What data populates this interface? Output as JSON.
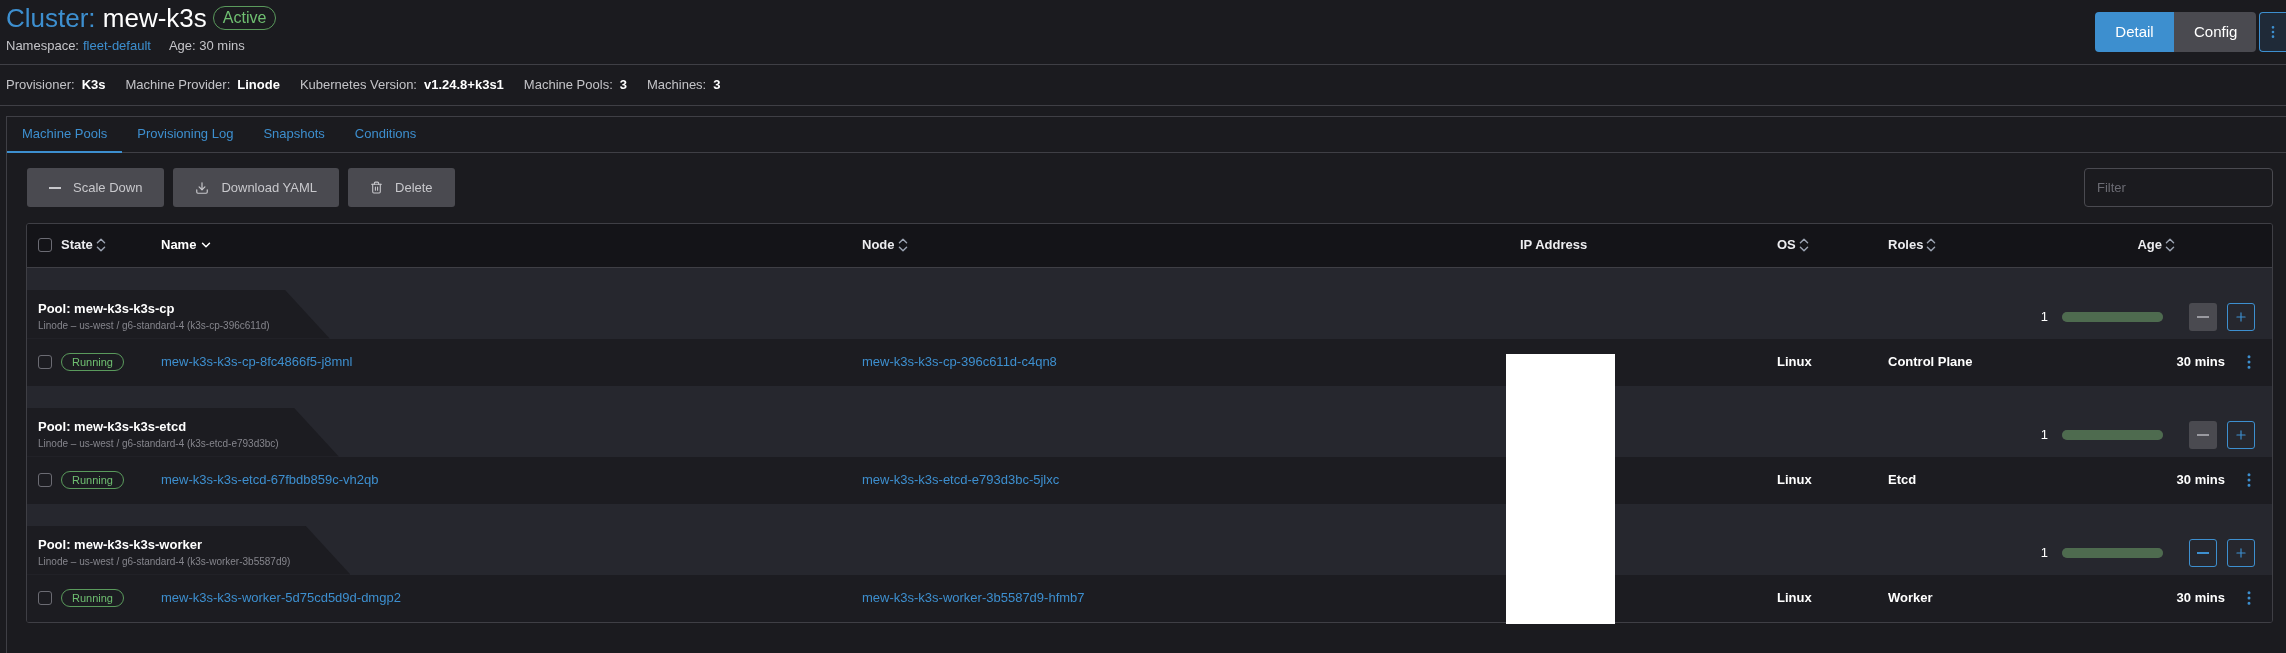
{
  "header": {
    "title_prefix": "Cluster:",
    "title": "mew-k3s",
    "status": "Active",
    "namespace_label": "Namespace:",
    "namespace": "fleet-default",
    "age": "Age: 30 mins"
  },
  "view_toggle": [
    {
      "label": "Detail",
      "selected": true
    },
    {
      "label": "Config",
      "selected": false
    }
  ],
  "info": [
    {
      "label": "Provisioner:",
      "value": "K3s"
    },
    {
      "label": "Machine Provider:",
      "value": "Linode"
    },
    {
      "label": "Kubernetes Version:",
      "value": "v1.24.8+k3s1"
    },
    {
      "label": "Machine Pools:",
      "value": "3"
    },
    {
      "label": "Machines:",
      "value": "3"
    }
  ],
  "tabs": [
    {
      "label": "Machine Pools",
      "selected": true
    },
    {
      "label": "Provisioning Log",
      "selected": false
    },
    {
      "label": "Snapshots",
      "selected": false
    },
    {
      "label": "Conditions",
      "selected": false
    }
  ],
  "actions": [
    {
      "label": "Scale Down",
      "kind": "minus"
    },
    {
      "label": "Download YAML",
      "kind": "download"
    },
    {
      "label": "Delete",
      "kind": "trash"
    }
  ],
  "filter": {
    "placeholder": "Filter"
  },
  "table": {
    "select_all_checked": false,
    "columns": [
      {
        "label": "State",
        "sortable": true,
        "selected": false
      },
      {
        "label": "Name",
        "sortable": true,
        "selected": true
      },
      {
        "label": "Node",
        "sortable": true,
        "selected": false
      },
      {
        "label": "IP Address",
        "sortable": false,
        "selected": false
      },
      {
        "label": "OS",
        "sortable": true,
        "selected": false
      },
      {
        "label": "Roles",
        "sortable": true,
        "selected": false
      },
      {
        "label": "Age",
        "sortable": true,
        "selected": false
      }
    ],
    "pools": [
      {
        "title": "Pool: mew-k3s-k3s-cp",
        "subtitle": "Linode – us-west / g6-standard-4 (k3s-cp-396c611d)",
        "count": "1",
        "level": 1,
        "scale_down_disabled": true,
        "machines": [
          {
            "checked": false,
            "state": "Running",
            "name": "mew-k3s-k3s-cp-8fc4866f5-j8mnl",
            "node": "mew-k3s-k3s-cp-396c611d-c4qn8",
            "os": "Linux",
            "roles": "Control Plane",
            "age": "30 mins"
          }
        ]
      },
      {
        "title": "Pool: mew-k3s-k3s-etcd",
        "subtitle": "Linode – us-west / g6-standard-4 (k3s-etcd-e793d3bc)",
        "count": "1",
        "level": 1,
        "scale_down_disabled": true,
        "machines": [
          {
            "checked": false,
            "state": "Running",
            "name": "mew-k3s-k3s-etcd-67fbdb859c-vh2qb",
            "node": "mew-k3s-k3s-etcd-e793d3bc-5jlxc",
            "os": "Linux",
            "roles": "Etcd",
            "age": "30 mins"
          }
        ]
      },
      {
        "title": "Pool: mew-k3s-k3s-worker",
        "subtitle": "Linode – us-west / g6-standard-4 (k3s-worker-3b5587d9)",
        "count": "1",
        "level": 1,
        "scale_down_disabled": false,
        "machines": [
          {
            "checked": false,
            "state": "Running",
            "name": "mew-k3s-k3s-worker-5d75cd5d9d-dmgp2",
            "node": "mew-k3s-k3s-worker-3b5587d9-hfmb7",
            "os": "Linux",
            "roles": "Worker",
            "age": "30 mins"
          }
        ]
      }
    ]
  }
}
